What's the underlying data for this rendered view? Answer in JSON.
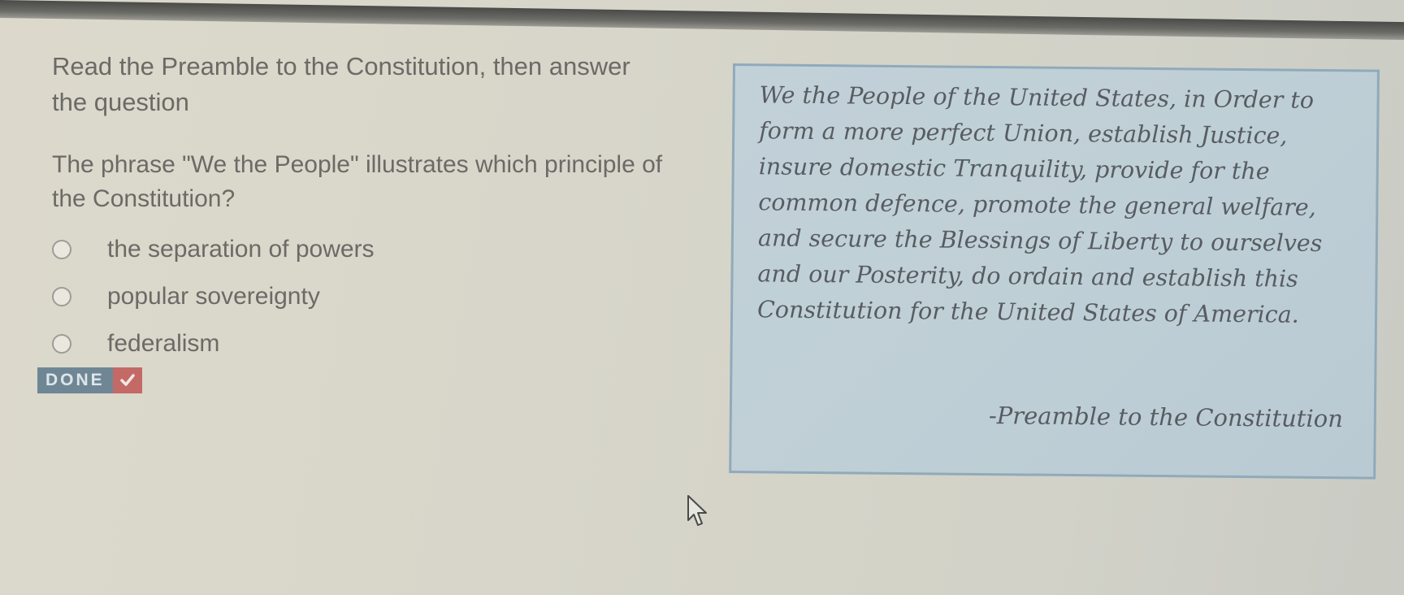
{
  "instruction": "Read the Preamble to the Constitution, then answer the question",
  "question": "The phrase \"We the People\" illustrates which principle of the Constitution?",
  "choices": [
    {
      "label": "the separation of powers"
    },
    {
      "label": "popular sovereignty"
    },
    {
      "label": "federalism"
    }
  ],
  "done_button": {
    "label": "DONE",
    "icon": "checkmark-icon"
  },
  "passage": {
    "text": "We the People of the United States, in Order to form a more perfect Union, establish Justice, insure domestic Tranquility, provide for the common defence, promote the general welfare, and secure the Blessings of Liberty to ourselves and our Posterity, do ordain and establish this Constitution for the United States of America.",
    "attribution": "-Preamble to the Constitution"
  },
  "colors": {
    "page_background": "#d8d6ca",
    "text": "#6b6a66",
    "passage_background": "#c0d0d7",
    "passage_border": "#8faabb",
    "done_button": "#6f8795",
    "done_check": "#c46a66"
  }
}
